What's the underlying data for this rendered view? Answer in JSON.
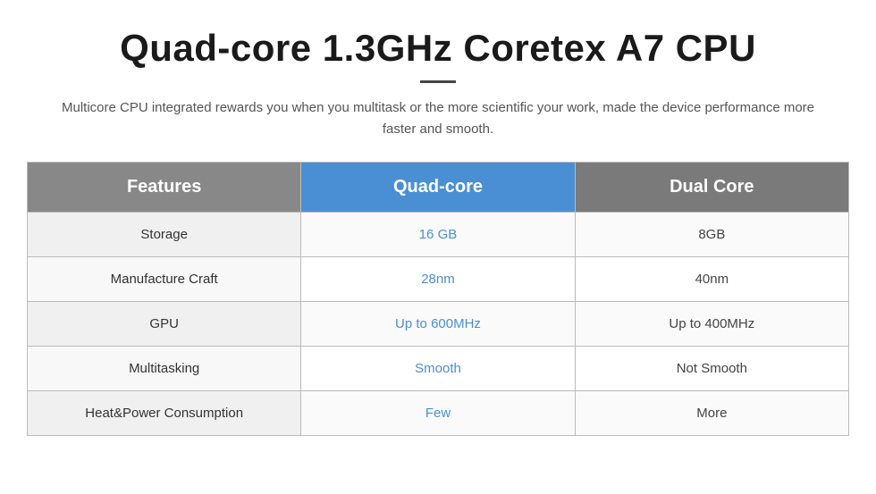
{
  "header": {
    "title": "Quad-core 1.3GHz Coretex A7 CPU",
    "subtitle": "Multicore CPU integrated rewards you when you multitask or the more scientific your work, made the device performance more faster and smooth."
  },
  "table": {
    "headers": {
      "features": "Features",
      "quadcore": "Quad-core",
      "dualcore": "Dual Core"
    },
    "rows": [
      {
        "feature": "Storage",
        "quadcore_value": "16 GB",
        "dualcore_value": "8GB"
      },
      {
        "feature": "Manufacture Craft",
        "quadcore_value": "28nm",
        "dualcore_value": "40nm"
      },
      {
        "feature": "GPU",
        "quadcore_value": "Up to 600MHz",
        "dualcore_value": "Up to 400MHz"
      },
      {
        "feature": "Multitasking",
        "quadcore_value": "Smooth",
        "dualcore_value": "Not Smooth"
      },
      {
        "feature": "Heat&Power Consumption",
        "quadcore_value": "Few",
        "dualcore_value": "More"
      }
    ]
  }
}
